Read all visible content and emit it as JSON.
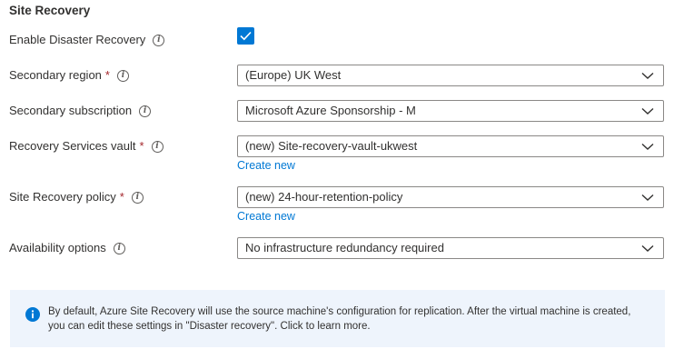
{
  "section": {
    "title": "Site Recovery"
  },
  "fields": {
    "enable_dr": {
      "label": "Enable Disaster Recovery",
      "checked": true
    },
    "secondary_region": {
      "label": "Secondary region",
      "required_mark": "*",
      "value": "(Europe) UK West"
    },
    "secondary_subscription": {
      "label": "Secondary subscription",
      "value": "Microsoft Azure Sponsorship - M"
    },
    "recovery_vault": {
      "label": "Recovery Services vault",
      "required_mark": "*",
      "value": "(new) Site-recovery-vault-ukwest",
      "create_new": "Create new"
    },
    "recovery_policy": {
      "label": "Site Recovery policy",
      "required_mark": "*",
      "value": "(new) 24-hour-retention-policy",
      "create_new": "Create new"
    },
    "availability": {
      "label": "Availability options",
      "value": "No infrastructure redundancy required"
    }
  },
  "info_banner": {
    "text": "By default, Azure Site Recovery will use the source machine's configuration for replication. After the virtual machine is created, you can edit these settings in \"Disaster recovery\". Click to learn more."
  },
  "icons": {
    "info": "info-circle-icon",
    "chevron": "chevron-down-icon",
    "check": "checkmark-icon"
  },
  "colors": {
    "accent": "#0078d4",
    "required": "#a4262c",
    "banner_bg": "#eef4fc"
  }
}
